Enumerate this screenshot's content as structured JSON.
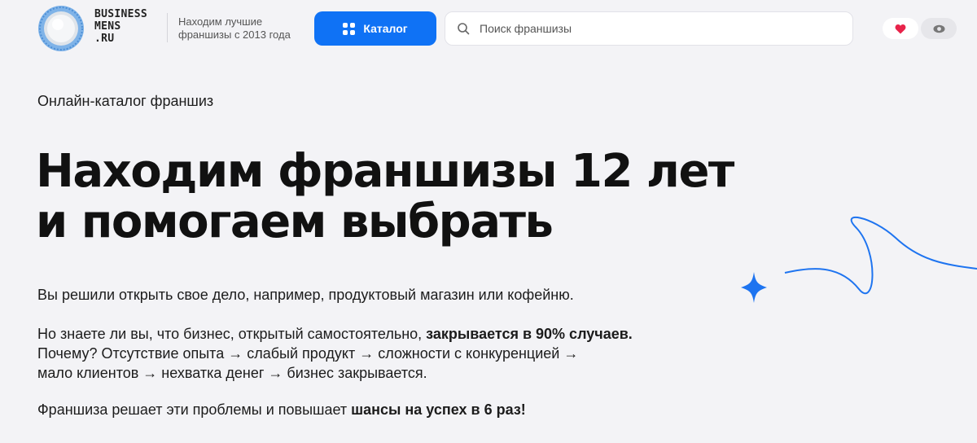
{
  "header": {
    "logo_lines": [
      "BUSINESS",
      "MENS",
      ".RU"
    ],
    "tagline": "Находим лучшие франшизы с 2013 года",
    "catalog_label": "Каталог",
    "search_placeholder": "Поиск франшизы"
  },
  "hero": {
    "eyebrow": "Онлайн-каталог франшиз",
    "headline_lines": [
      "Находим франшизы 12 лет",
      "и помогаем выбрать"
    ],
    "p1": "Вы решили открыть свое дело, например, продуктовый магазин или кофейню.",
    "p2_prefix": "Но знаете ли вы, что бизнес, открытый самостоятельно, ",
    "p2_bold": "закрывается в 90% случаев.",
    "p2_line2": "Почему? Отсутствие опыта → слабый продукт → сложности с конкуренцией →",
    "p2_line3": "мало клиентов → нехватка денег → бизнес закрывается.",
    "p3_prefix": "Франшиза решает эти проблемы и повышает ",
    "p3_bold": "шансы на успех в 6 раз!"
  },
  "colors": {
    "accent": "#0f72f5",
    "heart": "#e8234a",
    "background": "#f3f3f6"
  },
  "icons": [
    "logo-seal-icon",
    "grid-icon",
    "search-icon",
    "heart-icon",
    "eye-icon",
    "sparkle-icon"
  ]
}
